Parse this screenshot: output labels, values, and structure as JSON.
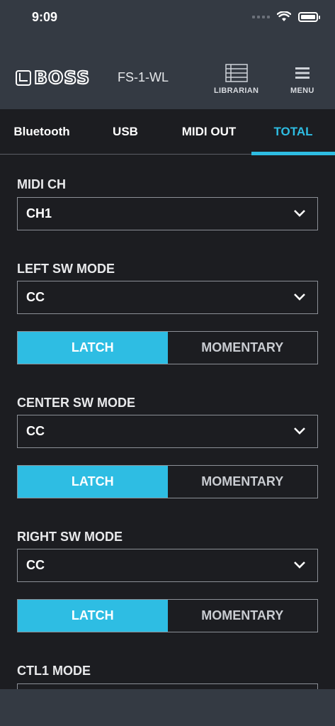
{
  "status": {
    "time": "9:09"
  },
  "header": {
    "logo_text": "BOSS",
    "model": "FS-1-WL",
    "librarian_label": "LIBRARIAN",
    "menu_label": "MENU"
  },
  "tabs": [
    {
      "label": "Bluetooth",
      "active": false
    },
    {
      "label": "USB",
      "active": false
    },
    {
      "label": "MIDI OUT",
      "active": false
    },
    {
      "label": "TOTAL",
      "active": true
    }
  ],
  "settings": {
    "midi_ch": {
      "label": "MIDI CH",
      "value": "CH1"
    },
    "left_sw": {
      "label": "LEFT SW MODE",
      "value": "CC",
      "latch": "LATCH",
      "momentary": "MOMENTARY",
      "selected": "LATCH"
    },
    "center_sw": {
      "label": "CENTER SW MODE",
      "value": "CC",
      "latch": "LATCH",
      "momentary": "MOMENTARY",
      "selected": "LATCH"
    },
    "right_sw": {
      "label": "RIGHT SW MODE",
      "value": "CC",
      "latch": "LATCH",
      "momentary": "MOMENTARY",
      "selected": "LATCH"
    },
    "ctl1": {
      "label": "CTL1 MODE"
    }
  },
  "colors": {
    "accent": "#2ebde3",
    "header_bg": "#343a43",
    "page_bg": "#1c1d21",
    "border": "#8c9097"
  },
  "icons": {
    "librarian": "list-grid-icon",
    "menu": "hamburger-icon",
    "dropdown": "chevron-down-icon",
    "wifi": "wifi-icon",
    "battery": "battery-icon",
    "signal": "cellular-signal-icon"
  }
}
